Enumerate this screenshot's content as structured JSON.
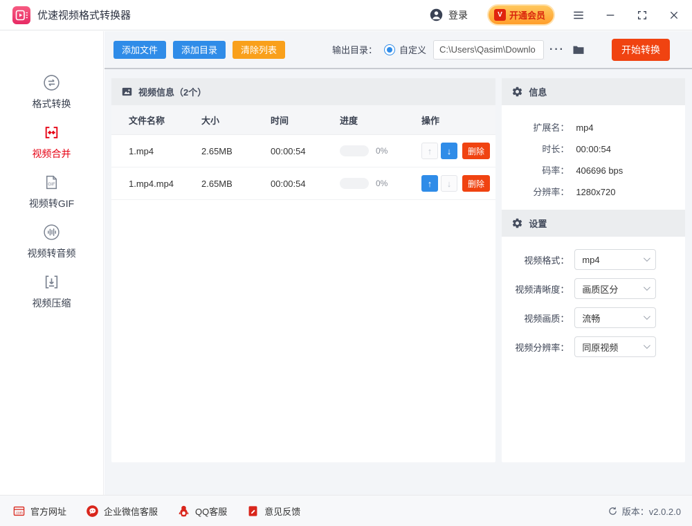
{
  "window": {
    "title": "优速视频格式转换器"
  },
  "titlebar": {
    "login_label": "登录",
    "vip_label": "开通会员",
    "vip_badge": "V"
  },
  "icons": {
    "up": "↑",
    "down": "↓"
  },
  "sidebar": {
    "items": [
      {
        "label": "格式转换",
        "icon": "format-convert",
        "active": false
      },
      {
        "label": "视频合并",
        "icon": "video-merge",
        "active": true
      },
      {
        "label": "视频转GIF",
        "icon": "video-to-gif",
        "active": false
      },
      {
        "label": "视频转音频",
        "icon": "video-to-audio",
        "active": false
      },
      {
        "label": "视频压缩",
        "icon": "video-compress",
        "active": false
      }
    ]
  },
  "toolbar": {
    "add_file": "添加文件",
    "add_dir": "添加目录",
    "clear_list": "清除列表",
    "output_dir_label": "输出目录：",
    "custom_label": "自定义",
    "path_value": "C:\\Users\\Qasim\\Downlo",
    "more_label": "···",
    "start_label": "开始转换"
  },
  "table": {
    "header": "视频信息（2个）",
    "columns": [
      "文件名称",
      "大小",
      "时间",
      "进度",
      "操作"
    ],
    "delete_label": "删除",
    "rows": [
      {
        "name": "1.mp4",
        "size": "2.65MB",
        "time": "00:00:54",
        "progress": "0%"
      },
      {
        "name": "1.mp4.mp4",
        "size": "2.65MB",
        "time": "00:00:54",
        "progress": "0%"
      }
    ]
  },
  "info_panel": {
    "title": "信息",
    "rows": [
      {
        "label": "扩展名：",
        "value": "mp4"
      },
      {
        "label": "时长：",
        "value": "00:00:54"
      },
      {
        "label": "码率：",
        "value": "406696 bps"
      },
      {
        "label": "分辨率：",
        "value": "1280x720"
      }
    ]
  },
  "settings_panel": {
    "title": "设置",
    "rows": [
      {
        "label": "视频格式：",
        "value": "mp4"
      },
      {
        "label": "视频清晰度：",
        "value": "画质区分"
      },
      {
        "label": "视频画质：",
        "value": "流畅"
      },
      {
        "label": "视频分辨率：",
        "value": "同原视频"
      }
    ]
  },
  "footer": {
    "links": [
      {
        "label": "官方网址",
        "icon": "website"
      },
      {
        "label": "企业微信客服",
        "icon": "wechat-service"
      },
      {
        "label": "QQ客服",
        "icon": "qq-service"
      },
      {
        "label": "意见反馈",
        "icon": "feedback"
      }
    ],
    "version_label": "版本：v2.0.2.0"
  },
  "colors": {
    "accent_blue": "#2f8ce8",
    "accent_orange": "#f9a01b",
    "action_red": "#f04311",
    "sidebar_active_red": "#e60012",
    "footer_icon_red": "#d9261c",
    "vip_pill_orange": "#ffa92f"
  }
}
